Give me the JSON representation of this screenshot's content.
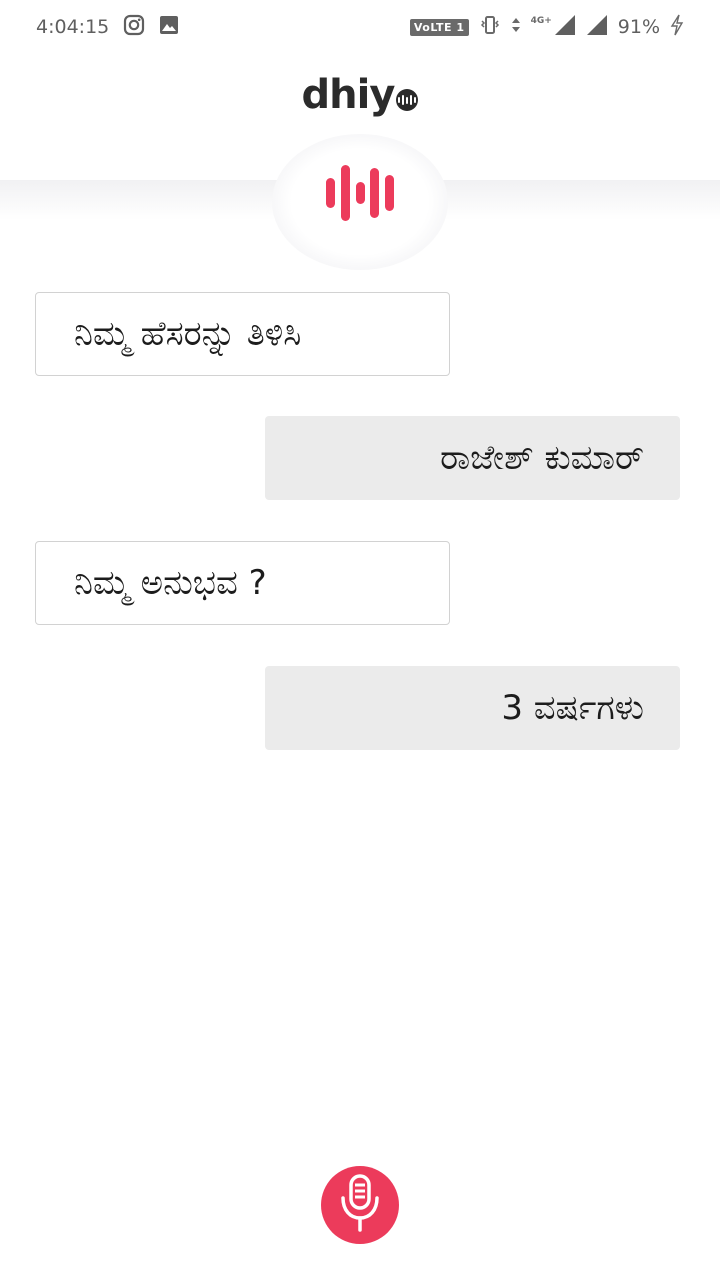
{
  "status_bar": {
    "time": "4:04:15",
    "volte": "VoLTE 1",
    "network": "4G+",
    "battery": "91%"
  },
  "header": {
    "logo_text": "dhiy"
  },
  "conversation": [
    {
      "role": "question",
      "text": "ನಿಮ್ಮ ಹೆಸರನ್ನು ತಿಳಿಸಿ"
    },
    {
      "role": "answer",
      "text": "ರಾಜೇಶ್ ಕುಮಾರ್"
    },
    {
      "role": "question",
      "text": "ನಿಮ್ಮ ಅನುಭವ ?"
    },
    {
      "role": "answer",
      "text": "3 ವರ್ಷಗಳು"
    }
  ],
  "icons": {
    "instagram": "instagram-icon",
    "gallery": "gallery-icon",
    "vibrate": "vibrate-icon",
    "data": "data-arrows-icon",
    "signal": "signal-icon",
    "charging": "charging-icon",
    "waveform": "waveform-icon",
    "mic": "microphone-icon"
  },
  "colors": {
    "accent": "#ec3b5b",
    "answer_bg": "#ebebeb",
    "question_border": "#d2d2d2"
  }
}
